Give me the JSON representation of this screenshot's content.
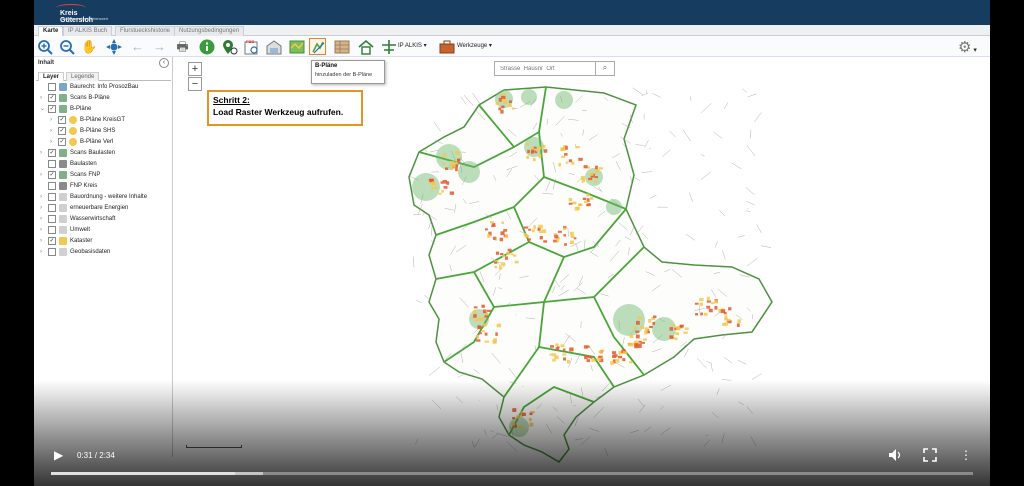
{
  "header": {
    "logo_line1": "Kreis Gütersloh",
    "logo_line2": "zukunftsorientiert & lebenswert"
  },
  "tabs": [
    "Karte",
    "IP ALKIS Buch",
    "Flurstueckshistorie",
    "Nutzungsbedingungen"
  ],
  "toolbar": {
    "icons": [
      "zoom-in",
      "zoom-out",
      "pan-hand",
      "navigate",
      "back-arrow",
      "forward-arrow",
      "print",
      "info",
      "identify-pin",
      "fbb-search",
      "building-search",
      "map-layers",
      "load-raster",
      "map-sheet",
      "home",
      "ip-alkis"
    ],
    "ip_alkis_label": "IP ALKIS",
    "werkzeuge_label": "Werkzeuge",
    "dropdown_caret": "▾"
  },
  "panel": {
    "title": "Inhalt",
    "tabs": [
      "Layer",
      "Legende"
    ],
    "layers": [
      {
        "label": "Baurecht: Info ProsozBau",
        "checked": false,
        "expand": "",
        "indent": 0,
        "color": "#7aa7c7"
      },
      {
        "label": "Scans B-Pläne",
        "checked": true,
        "expand": "›",
        "indent": 0,
        "color": "#7fb08a"
      },
      {
        "label": "B-Pläne",
        "checked": true,
        "expand": "⌄",
        "indent": 0,
        "color": "#7fb08a"
      },
      {
        "label": "B-Pläne KreisGT",
        "checked": true,
        "expand": "›",
        "indent": 1,
        "color": "#f2c94c"
      },
      {
        "label": "B-Pläne SHS",
        "checked": true,
        "expand": "›",
        "indent": 1,
        "color": "#f2c94c"
      },
      {
        "label": "B-Pläne Verl",
        "checked": true,
        "expand": "›",
        "indent": 1,
        "color": "#f2c94c"
      },
      {
        "label": "Scans Baulasten",
        "checked": true,
        "expand": "›",
        "indent": 0,
        "color": "#7fb08a"
      },
      {
        "label": "Baulasten",
        "checked": false,
        "expand": "",
        "indent": 0,
        "color": "#8a8a8a"
      },
      {
        "label": "Scans FNP",
        "checked": true,
        "expand": "›",
        "indent": 0,
        "color": "#7fb08a"
      },
      {
        "label": "FNP Kreis",
        "checked": false,
        "expand": "",
        "indent": 0,
        "color": "#8a8a8a"
      },
      {
        "label": "Bauordnung - weitere Inhalte",
        "checked": false,
        "expand": "›",
        "indent": 0,
        "color": "#d0d0d0"
      },
      {
        "label": "erneuerbare Energien",
        "checked": false,
        "expand": "›",
        "indent": 0,
        "color": "#d0d0d0"
      },
      {
        "label": "Wasserwirtschaft",
        "checked": false,
        "expand": "›",
        "indent": 0,
        "color": "#d0d0d0"
      },
      {
        "label": "Umwelt",
        "checked": false,
        "expand": "›",
        "indent": 0,
        "color": "#d0d0d0"
      },
      {
        "label": "Kataster",
        "checked": true,
        "expand": "›",
        "indent": 0,
        "color": "#f2c94c"
      },
      {
        "label": "Geobasisdaten",
        "checked": false,
        "expand": "›",
        "indent": 0,
        "color": "#d0d0d0"
      }
    ]
  },
  "map": {
    "zoom_in": "+",
    "zoom_out": "−",
    "search_placeholder": "Strasse  Hausnr  Ort",
    "search_icon": "⌕",
    "tooltip_title": "B-Pläne",
    "tooltip_text": "hinzuladen der B-Pläne",
    "callout_heading": "Schritt 2:",
    "callout_body": "Load Raster Werkzeug aufrufen."
  },
  "video": {
    "time": "0:31 / 2:34",
    "progress": 0.2,
    "buffered": 0.23,
    "play_icon": "▶",
    "volume_icon": "🔊",
    "fullscreen_icon": "⛶",
    "more_icon": "⋮"
  },
  "colors": {
    "header": "#163d5f",
    "accent": "#e39423",
    "boundary": "#4aa63a",
    "plan_red": "#e4572e",
    "plan_yellow": "#f2c94c",
    "green_circle": "#6db56b"
  }
}
